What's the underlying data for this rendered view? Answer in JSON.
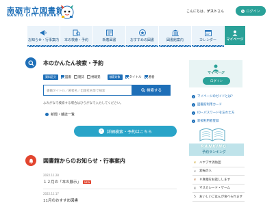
{
  "header": {
    "logo_jp": "南砺市立図書館",
    "logo_en": "NANTO CITY LIBRARY",
    "greeting_prefix": "こんにちは、",
    "greeting_user": "ゲスト",
    "greeting_suffix": "さん",
    "login_label": "ログイン"
  },
  "nav": {
    "items": [
      {
        "label": "お知らせ・行事案内",
        "icon": "megaphone-icon"
      },
      {
        "label": "本の検索・予約",
        "icon": "book-search-icon"
      },
      {
        "label": "新着図書",
        "icon": "new-books-icon"
      },
      {
        "label": "おすすめの図書",
        "icon": "recommend-icon"
      },
      {
        "label": "図書館案内",
        "icon": "building-icon"
      },
      {
        "label": "カレンダー",
        "icon": "calendar-icon"
      }
    ],
    "mypage_label": "マイページ"
  },
  "search": {
    "title": "本のかんたん検索・予約",
    "filter_type_label": "資料区分",
    "filter_types": [
      "図書",
      "雑誌",
      "視聴覚"
    ],
    "filter_target_label": "検索対象",
    "filter_targets": [
      "タイトル",
      "著者"
    ],
    "placeholder": "書籍タイトル／著者名／出版社名等で検索",
    "button_label": "検索する",
    "hint": "よみがなで検索する場合はひらがなで入力してください。",
    "newspaper_link": "新聞・雑誌一覧",
    "advanced_button": "詳細検索・予約はこちら"
  },
  "news": {
    "title": "図書館からのお知らせ・行事案内",
    "items": [
      {
        "date": "2022.11.28",
        "title": "１２月の「本の展示」",
        "new_label": "NEW"
      },
      {
        "date": "2022.11.17",
        "title": "11月のおすすめ図書"
      }
    ]
  },
  "sidebar": {
    "mypage_label": "マイページ",
    "login_label": "ログイン",
    "links": [
      "マイページのガイドとは？",
      "図書館利用カード",
      "ID・パスワードを忘れた方",
      "新規利用者登録"
    ],
    "ranking_en": "RANKING",
    "ranking_jp": "予約ランキング",
    "ranking": [
      {
        "rank": "1",
        "title": "ハヤブサ消防団"
      },
      {
        "rank": "2",
        "title": "変転の人"
      },
      {
        "rank": "3",
        "title": "＃真相をお話しします"
      },
      {
        "rank": "4",
        "title": "マスカレード・ゲーム"
      },
      {
        "rank": "5",
        "title": "おいしいごはんが食べられます"
      }
    ]
  },
  "colors": {
    "brand_blue": "#1e6fb8",
    "teal": "#2aa198",
    "news_red": "#e2452f"
  }
}
